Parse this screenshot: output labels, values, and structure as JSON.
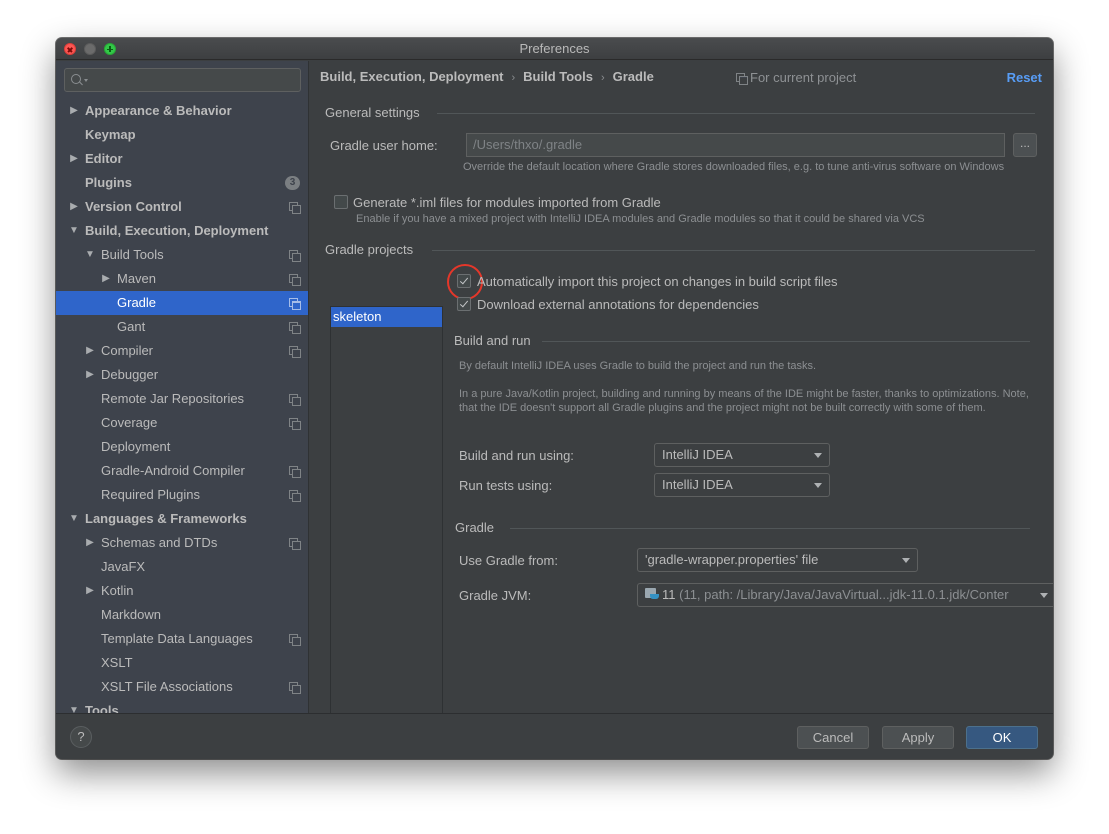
{
  "window": {
    "title": "Preferences"
  },
  "sidebar": {
    "search_placeholder": "",
    "items": [
      {
        "label": "Appearance & Behavior",
        "level": 0,
        "bold": true,
        "arrow": "right",
        "project": false
      },
      {
        "label": "Keymap",
        "level": 0,
        "bold": true,
        "arrow": "none",
        "project": false
      },
      {
        "label": "Editor",
        "level": 0,
        "bold": true,
        "arrow": "right",
        "project": false
      },
      {
        "label": "Plugins",
        "level": 0,
        "bold": true,
        "arrow": "none",
        "project": false,
        "badge": "3"
      },
      {
        "label": "Version Control",
        "level": 0,
        "bold": true,
        "arrow": "right",
        "project": true
      },
      {
        "label": "Build, Execution, Deployment",
        "level": 0,
        "bold": true,
        "arrow": "down",
        "project": false
      },
      {
        "label": "Build Tools",
        "level": 1,
        "bold": false,
        "arrow": "down",
        "project": true
      },
      {
        "label": "Maven",
        "level": 2,
        "bold": false,
        "arrow": "right",
        "project": true
      },
      {
        "label": "Gradle",
        "level": 2,
        "bold": false,
        "arrow": "none",
        "project": true,
        "selected": true
      },
      {
        "label": "Gant",
        "level": 2,
        "bold": false,
        "arrow": "none",
        "project": true
      },
      {
        "label": "Compiler",
        "level": 1,
        "bold": false,
        "arrow": "right",
        "project": true
      },
      {
        "label": "Debugger",
        "level": 1,
        "bold": false,
        "arrow": "right",
        "project": false
      },
      {
        "label": "Remote Jar Repositories",
        "level": 1,
        "bold": false,
        "arrow": "none",
        "project": true
      },
      {
        "label": "Coverage",
        "level": 1,
        "bold": false,
        "arrow": "none",
        "project": true
      },
      {
        "label": "Deployment",
        "level": 1,
        "bold": false,
        "arrow": "none",
        "project": false
      },
      {
        "label": "Gradle-Android Compiler",
        "level": 1,
        "bold": false,
        "arrow": "none",
        "project": true
      },
      {
        "label": "Required Plugins",
        "level": 1,
        "bold": false,
        "arrow": "none",
        "project": true
      },
      {
        "label": "Languages & Frameworks",
        "level": 0,
        "bold": true,
        "arrow": "down",
        "project": false
      },
      {
        "label": "Schemas and DTDs",
        "level": 1,
        "bold": false,
        "arrow": "right",
        "project": true
      },
      {
        "label": "JavaFX",
        "level": 1,
        "bold": false,
        "arrow": "none",
        "project": false
      },
      {
        "label": "Kotlin",
        "level": 1,
        "bold": false,
        "arrow": "right",
        "project": false
      },
      {
        "label": "Markdown",
        "level": 1,
        "bold": false,
        "arrow": "none",
        "project": false
      },
      {
        "label": "Template Data Languages",
        "level": 1,
        "bold": false,
        "arrow": "none",
        "project": true
      },
      {
        "label": "XSLT",
        "level": 1,
        "bold": false,
        "arrow": "none",
        "project": false
      },
      {
        "label": "XSLT File Associations",
        "level": 1,
        "bold": false,
        "arrow": "none",
        "project": true
      },
      {
        "label": "Tools",
        "level": 0,
        "bold": true,
        "arrow": "down",
        "project": false
      }
    ]
  },
  "header": {
    "breadcrumb": [
      "Build, Execution, Deployment",
      "Build Tools",
      "Gradle"
    ],
    "separator": "›",
    "scope_label": "For current project",
    "reset_label": "Reset"
  },
  "general_settings": {
    "title": "General settings",
    "user_home_label": "Gradle user home:",
    "user_home_value": "/Users/thxo/.gradle",
    "user_home_hint": "Override the default location where Gradle stores downloaded files, e.g. to tune anti-virus software on Windows",
    "browse_label": "...",
    "generate_iml_label": "Generate *.iml files for modules imported from Gradle",
    "generate_iml_checked": false,
    "generate_iml_hint": "Enable if you have a mixed project with IntelliJ IDEA modules and Gradle modules so that it could be shared via VCS"
  },
  "gradle_projects": {
    "title": "Gradle projects",
    "projects": [
      "skeleton"
    ],
    "selected_project": "skeleton",
    "auto_import_label": "Automatically import this project on changes in build script files",
    "auto_import_checked": true,
    "download_annotations_label": "Download external annotations for dependencies",
    "download_annotations_checked": true
  },
  "build_and_run": {
    "title": "Build and run",
    "hint1": "By default IntelliJ IDEA uses Gradle to build the project and run the tasks.",
    "hint2": "In a pure Java/Kotlin project, building and running by means of the IDE might be faster, thanks to optimizations. Note, that the IDE doesn't support all Gradle plugins and the project might not be built correctly with some of them.",
    "build_run_label": "Build and run using:",
    "build_run_value": "IntelliJ IDEA",
    "run_tests_label": "Run tests using:",
    "run_tests_value": "IntelliJ IDEA"
  },
  "gradle": {
    "title": "Gradle",
    "use_from_label": "Use Gradle from:",
    "use_from_value": "'gradle-wrapper.properties' file",
    "jvm_label": "Gradle JVM:",
    "jvm_value_main": "11",
    "jvm_value_detail": " (11, path: /Library/Java/JavaVirtual...jdk-11.0.1.jdk/Conter",
    "jvm_browse_label": "..."
  },
  "footer": {
    "help_label": "?",
    "cancel_label": "Cancel",
    "apply_label": "Apply",
    "ok_label": "OK"
  },
  "colors": {
    "accent": "#2f65ca",
    "link": "#589df6",
    "primary_button": "#365880",
    "highlight_ring": "#e5372a"
  }
}
